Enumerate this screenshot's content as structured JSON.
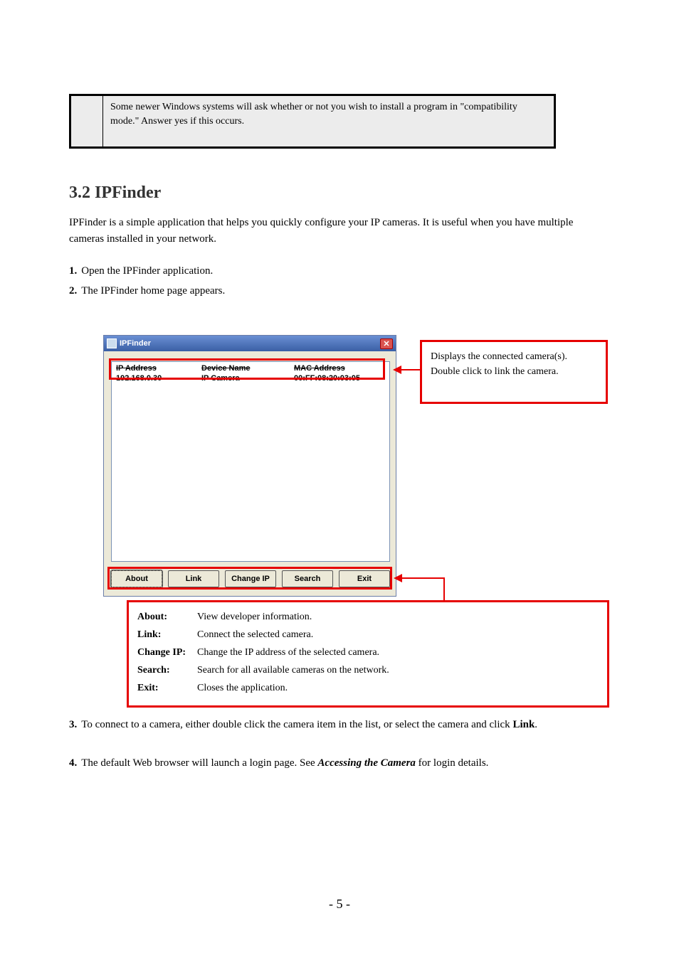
{
  "noteBox": {
    "text": "Some newer Windows systems will ask whether or not you wish to install a program in \"compatibility mode.\" Answer yes if this occurs."
  },
  "sectionTitle": "3.2 IPFinder",
  "intro": "IPFinder is a simple application that helps you quickly configure your IP cameras. It is useful when you have multiple cameras installed in your network.",
  "steps": [
    "Open the IPFinder application.",
    "The IPFinder home page appears."
  ],
  "ipfinder": {
    "title": "IPFinder",
    "headers": {
      "ip": "IP Address",
      "device": "Device Name",
      "mac": "MAC Address"
    },
    "row": {
      "ip": "192.168.0.30",
      "device": "IP Camera",
      "mac": "00:FF:08:20:03:05"
    },
    "buttons": {
      "about": "About",
      "link": "Link",
      "changeip": "Change IP",
      "search": "Search",
      "exit": "Exit"
    }
  },
  "calloutTop": {
    "line1": "Displays the connected camera(s).",
    "line2": "Double click to link the camera."
  },
  "calloutBottom": [
    {
      "label": "About:",
      "desc": "View developer information."
    },
    {
      "label": "Link:",
      "desc": "Connect the selected camera."
    },
    {
      "label": "Change IP:",
      "desc": "Change the IP address of the selected camera."
    },
    {
      "label": "Search:",
      "desc": "Search for all available cameras on the network."
    },
    {
      "label": "Exit:",
      "desc": "Closes the application."
    }
  ],
  "step3": {
    "a": "To connect to a camera, either double click the camera item in the list, or select the camera and click ",
    "b": "Link",
    "c": "."
  },
  "step4": {
    "a": "The default Web browser will launch a login page. See ",
    "b": "Accessing the Camera",
    "c": " for login details."
  },
  "pageNum": "- 5 -"
}
